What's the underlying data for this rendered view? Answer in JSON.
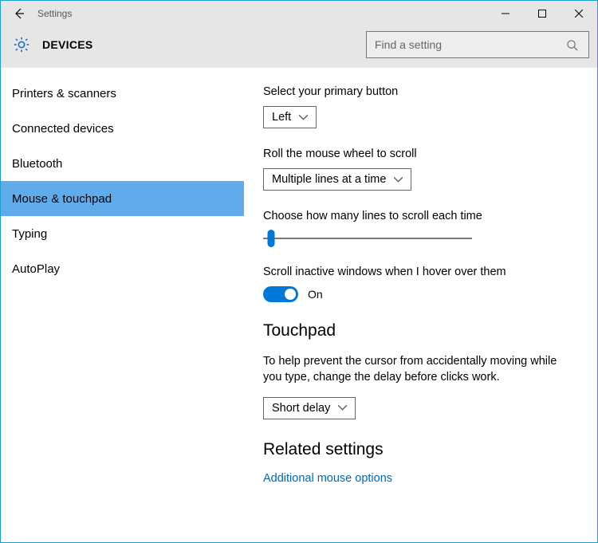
{
  "window": {
    "title": "Settings"
  },
  "header": {
    "label": "DEVICES",
    "search_placeholder": "Find a setting"
  },
  "sidebar": {
    "items": [
      {
        "label": "Printers & scanners"
      },
      {
        "label": "Connected devices"
      },
      {
        "label": "Bluetooth"
      },
      {
        "label": "Mouse & touchpad"
      },
      {
        "label": "Typing"
      },
      {
        "label": "AutoPlay"
      }
    ],
    "selected_index": 3
  },
  "main": {
    "primary_button": {
      "label": "Select your primary button",
      "value": "Left"
    },
    "scroll_mode": {
      "label": "Roll the mouse wheel to scroll",
      "value": "Multiple lines at a time"
    },
    "scroll_lines": {
      "label": "Choose how many lines to scroll each time",
      "position_pct": 4
    },
    "inactive_scroll": {
      "label": "Scroll inactive windows when I hover over them",
      "value": "On"
    },
    "touchpad": {
      "heading": "Touchpad",
      "delay_help": "To help prevent the cursor from accidentally moving while you type, change the delay before clicks work.",
      "delay_value": "Short delay"
    },
    "related": {
      "heading": "Related settings",
      "link": "Additional mouse options"
    }
  }
}
